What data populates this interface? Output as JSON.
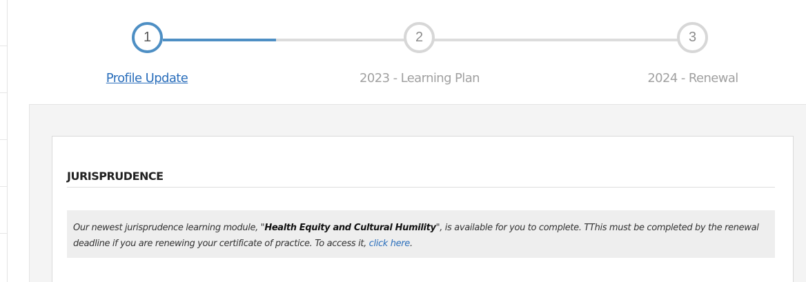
{
  "stepper": {
    "steps": [
      {
        "number": "1",
        "label": "Profile Update",
        "state": "active"
      },
      {
        "number": "2",
        "label": "2023 - Learning Plan",
        "state": "inactive"
      },
      {
        "number": "3",
        "label": "2024 - Renewal",
        "state": "inactive"
      }
    ],
    "progress_fraction_first_segment": 0.5
  },
  "section": {
    "heading": "JURISPRUDENCE",
    "notice": {
      "text_before": "Our newest jurisprudence learning module, \"",
      "module_name": "Health Equity and Cultural Humility",
      "text_middle": "\", is available for you to complete. TThis must be completed by the renewal deadline if you are renewing your certificate of practice. To access it, ",
      "link_text": "click here",
      "text_after": "."
    }
  },
  "colors": {
    "accent": "#4e8fc4",
    "link": "#2a6ebb",
    "inactive": "#d7d7d7",
    "panel_background": "#f4f4f4",
    "notice_background": "#eeeeee"
  }
}
